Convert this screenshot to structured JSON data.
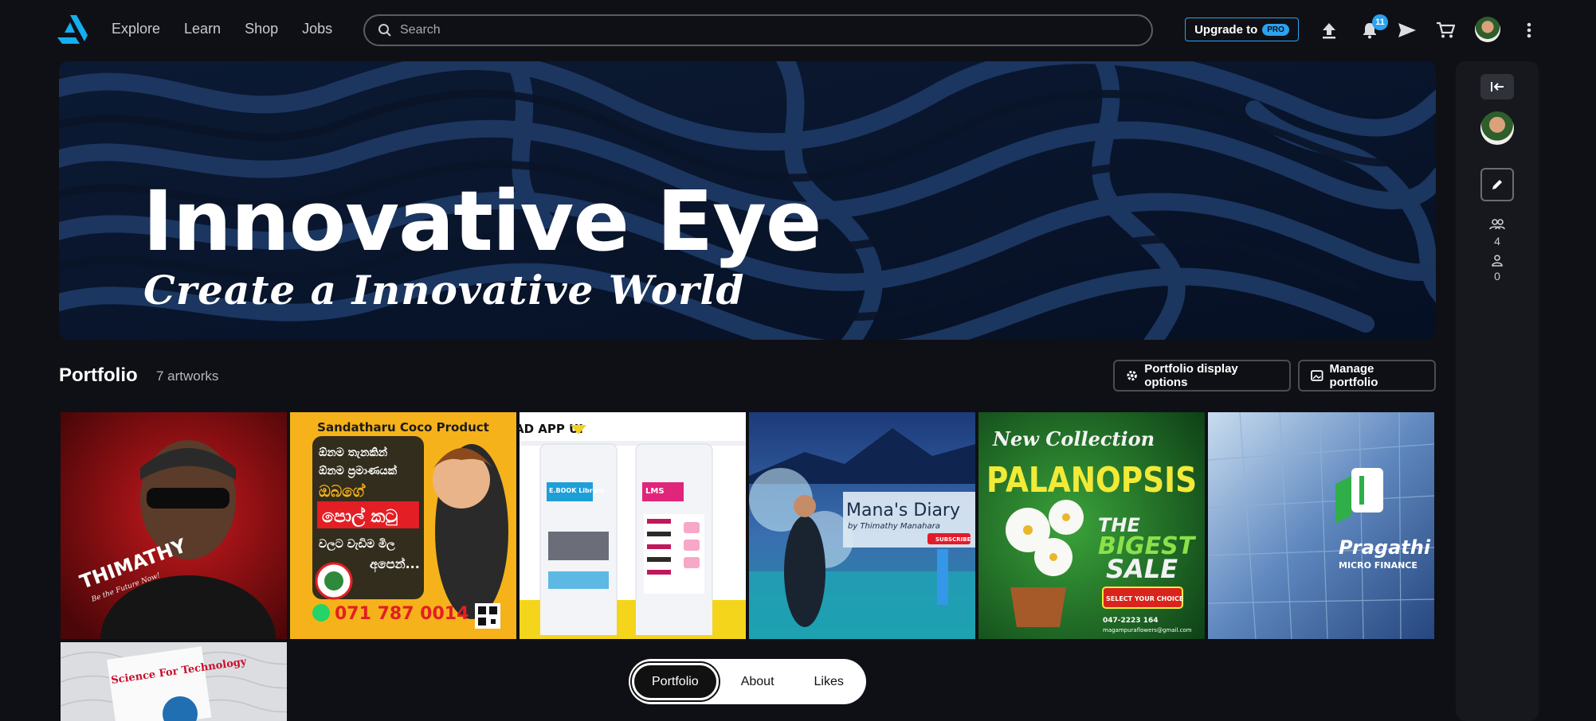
{
  "nav": {
    "items": [
      "Explore",
      "Learn",
      "Shop",
      "Jobs"
    ]
  },
  "search": {
    "placeholder": "Search"
  },
  "upgrade": {
    "label": "Upgrade to",
    "badge": "PRO"
  },
  "notifications": {
    "count": "11"
  },
  "banner": {
    "title": "Innovative Eye",
    "subtitle": "Create a Innovative World"
  },
  "sidebar": {
    "followers": "4",
    "following": "0"
  },
  "portfolio": {
    "title": "Portfolio",
    "count": "7 artworks",
    "display_options_label": "Portfolio display options",
    "manage_label": "Manage portfolio"
  },
  "artworks": [
    {
      "text": "THIMATHY",
      "sub": "Be the Future Now!"
    },
    {
      "title": "Sandatharu Coco Product",
      "lines": [
        "ඕනම තැනකින්",
        "ඕනම ප්‍රමාණයක්",
        "ඔබගේ",
        "පොල් කටු",
        "වලට වැඩිම මිල",
        "අපෙන්..."
      ],
      "phone": "071 787 0014"
    },
    {
      "title": "AD APP UI",
      "labels": [
        "E.BOOK Library",
        "LMS"
      ]
    },
    {
      "title": "Mana's Diary",
      "sub": "by Thimathy Manahara",
      "button": "SUBSCRIBE"
    },
    {
      "top": "New Collection",
      "title": "PALANOPSIS",
      "line1": "THE",
      "line2": "BIGEST",
      "line3": "SALE",
      "tag": "SELECT YOUR CHOICE",
      "phone": "047-2223 164",
      "email": "magampuraflowers@gmail.com"
    },
    {
      "title": "Pragathi",
      "sub": "MICRO FINANCE"
    },
    {
      "title": "Science For Technology"
    }
  ],
  "tabs": {
    "items": [
      "Portfolio",
      "About",
      "Likes"
    ],
    "active": "Portfolio"
  },
  "colors": {
    "accent": "#2aa3f0",
    "background": "#0f1015",
    "panel": "#17181e"
  }
}
